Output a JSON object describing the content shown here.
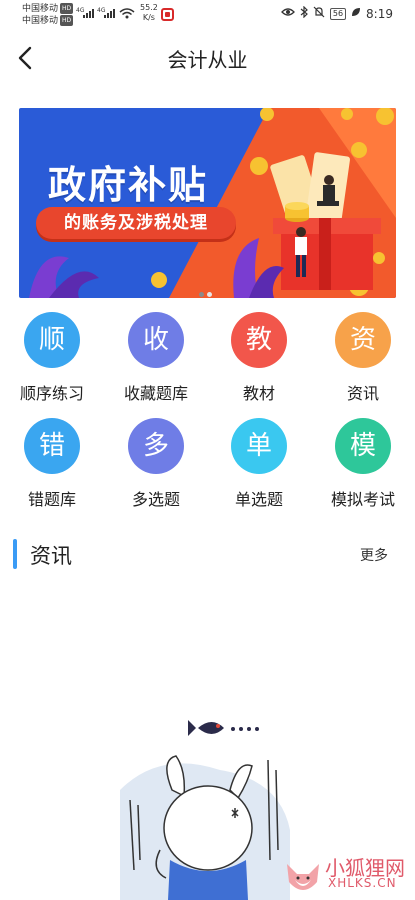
{
  "status_bar": {
    "carrier1": "中国移动",
    "carrier2": "中国移动",
    "hd_badge": "HD",
    "net_speed": "55.2",
    "net_speed_unit": "K/s",
    "battery": "56",
    "time": "8:19",
    "icons": [
      "signal-4g-icon",
      "signal-4g-icon",
      "wifi-icon",
      "app-notification-icon",
      "eye-icon",
      "bluetooth-icon",
      "mute-icon",
      "leaf-icon"
    ]
  },
  "header": {
    "title": "会计从业",
    "back_icon": "chevron-left-icon"
  },
  "banner": {
    "title": "政府补贴",
    "subtitle": "的账务及涉税处理",
    "colors": {
      "background": "#2a5bd7",
      "accent": "#f25a2c",
      "pill": "#e8462d"
    }
  },
  "grid": [
    {
      "char": "顺",
      "label": "顺序练习",
      "color": "#3aa6f0"
    },
    {
      "char": "收",
      "label": "收藏题库",
      "color": "#6f7de6"
    },
    {
      "char": "教",
      "label": "教材",
      "color": "#f2564b"
    },
    {
      "char": "资",
      "label": "资讯",
      "color": "#f7a24a"
    },
    {
      "char": "错",
      "label": "错题库",
      "color": "#3aa6f0"
    },
    {
      "char": "多",
      "label": "多选题",
      "color": "#6f7de6"
    },
    {
      "char": "单",
      "label": "单选题",
      "color": "#3ac8f0"
    },
    {
      "char": "模",
      "label": "模拟考试",
      "color": "#2ec79a"
    }
  ],
  "news": {
    "title": "资讯",
    "more": "更多",
    "accent": "#3a9bf5"
  },
  "watermark": {
    "text": "小狐狸网",
    "sub": "XHLKS.CN"
  }
}
